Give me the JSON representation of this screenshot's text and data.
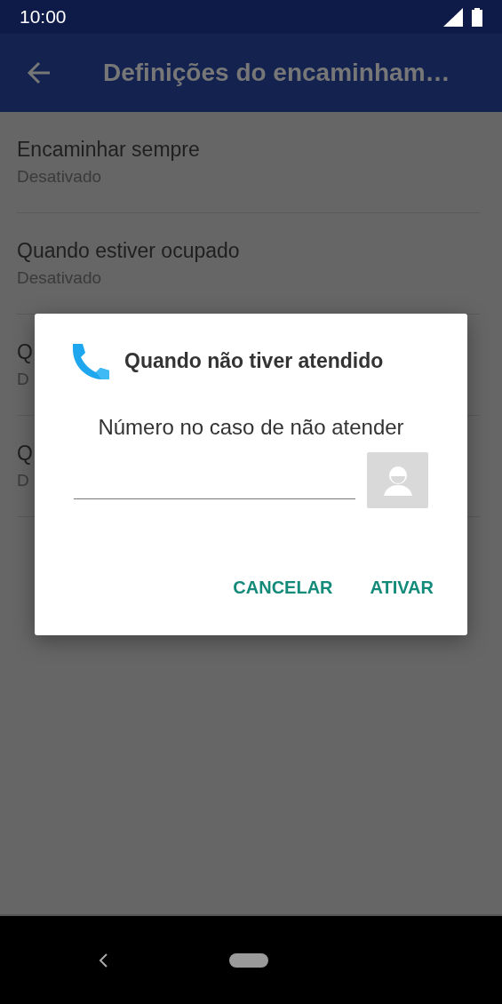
{
  "status_bar": {
    "time": "10:00"
  },
  "app_bar": {
    "title": "Definições do encaminham…"
  },
  "settings": [
    {
      "title": "Encaminhar sempre",
      "summary": "Desativado"
    },
    {
      "title": "Quando estiver ocupado",
      "summary": "Desativado"
    },
    {
      "title": "Q",
      "summary": "D"
    },
    {
      "title": "Q",
      "summary": "D"
    }
  ],
  "dialog": {
    "title": "Quando não tiver atendido",
    "message": "Número no caso de não atender",
    "buttons": [
      {
        "label": "CANCELAR"
      },
      {
        "label": "ATIVAR"
      }
    ]
  }
}
